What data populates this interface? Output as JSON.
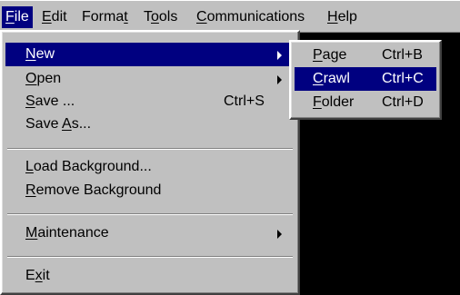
{
  "menubar": {
    "items": [
      {
        "pre": "",
        "key": "F",
        "post": "ile"
      },
      {
        "pre": "",
        "key": "E",
        "post": "dit"
      },
      {
        "pre": "Forma",
        "key": "t",
        "post": ""
      },
      {
        "pre": "T",
        "key": "o",
        "post": "ols"
      },
      {
        "pre": "",
        "key": "C",
        "post": "ommunications"
      },
      {
        "pre": "",
        "key": "H",
        "post": "elp"
      }
    ]
  },
  "file_menu": {
    "items": [
      {
        "pre": "",
        "key": "N",
        "post": "ew",
        "shortcut": ""
      },
      {
        "pre": "",
        "key": "O",
        "post": "pen",
        "shortcut": ""
      },
      {
        "pre": "",
        "key": "S",
        "post": "ave ...",
        "shortcut": "Ctrl+S"
      },
      {
        "pre": "Save ",
        "key": "A",
        "post": "s...",
        "shortcut": ""
      },
      {
        "pre": "",
        "key": "L",
        "post": "oad Background...",
        "shortcut": ""
      },
      {
        "pre": "",
        "key": "R",
        "post": "emove Background",
        "shortcut": ""
      },
      {
        "pre": "",
        "key": "M",
        "post": "aintenance",
        "shortcut": ""
      },
      {
        "pre": "E",
        "key": "x",
        "post": "it",
        "shortcut": ""
      }
    ]
  },
  "new_submenu": {
    "items": [
      {
        "pre": "",
        "key": "P",
        "post": "age",
        "shortcut": "Ctrl+B"
      },
      {
        "pre": "",
        "key": "C",
        "post": "rawl",
        "shortcut": "Ctrl+C"
      },
      {
        "pre": "",
        "key": "F",
        "post": "older",
        "shortcut": "Ctrl+D"
      }
    ]
  },
  "colors": {
    "menu_face": "#c0c0c0",
    "highlight": "#000080",
    "highlight_text": "#ffffff",
    "desktop": "#000000"
  }
}
